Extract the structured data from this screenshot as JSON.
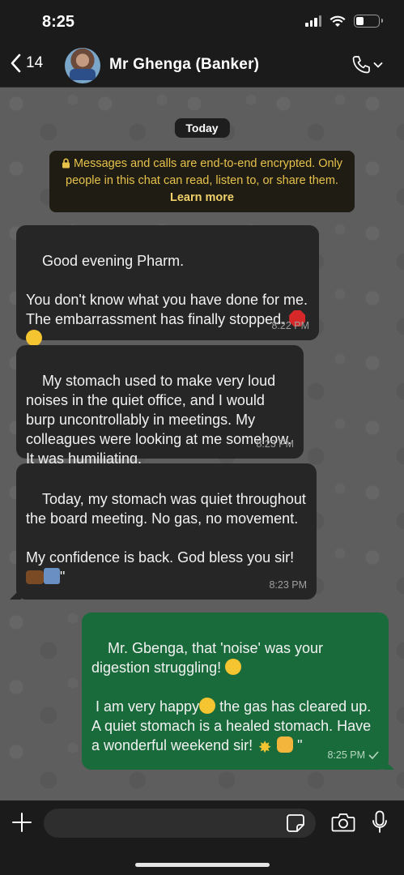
{
  "status_bar": {
    "time": "8:25"
  },
  "header": {
    "back_count": "14",
    "contact_name": "Mr Ghenga (Banker)"
  },
  "chat": {
    "date_label": "Today",
    "encryption_notice": {
      "text": "Messages and calls are end-to-end encrypted. Only people in this chat can read, listen to, or share them.",
      "link": "Learn more"
    },
    "messages": [
      {
        "direction": "incoming",
        "text": "Good evening Pharm.\n\nYou don't know what you have done for me. The embarrassment has finally stopped.",
        "emojis": [
          "stop-sign",
          "zipper-mouth-face"
        ],
        "time": "8:22 PM"
      },
      {
        "direction": "incoming",
        "text": "My stomach used to make very loud noises in the quiet office, and I would burp uncontrollably in meetings. My colleagues were looking at me somehow. It was humiliating.",
        "time": "8:23 PM"
      },
      {
        "direction": "incoming",
        "text_part1": "Today, my stomach was quiet throughout the board meeting. No gas, no movement.\n\nMy confidence is back. God bless you sir!",
        "emojis": [
          "briefcase",
          "shirt-and-tie"
        ],
        "text_suffix": "\"",
        "time": "8:23 PM"
      },
      {
        "direction": "outgoing",
        "text_part1": "Mr. Gbenga, that 'noise' was your digestion struggling!",
        "text_part2": " I am very happy",
        "text_part3": " the gas has cleared up. A quiet stomach is a healed stomach. Have a wonderful weekend sir!",
        "text_suffix": "\"",
        "emojis": [
          "smiley",
          "grinning-face",
          "sparkle-star",
          "fist"
        ],
        "time": "8:25 PM",
        "status": "sent-check"
      }
    ]
  },
  "input_bar": {
    "placeholder": ""
  },
  "colors": {
    "incoming_bubble": "#262626",
    "outgoing_bubble": "#1a6b3b",
    "encryption_text": "#e6c24b",
    "chat_background": "#5e5e5e"
  }
}
